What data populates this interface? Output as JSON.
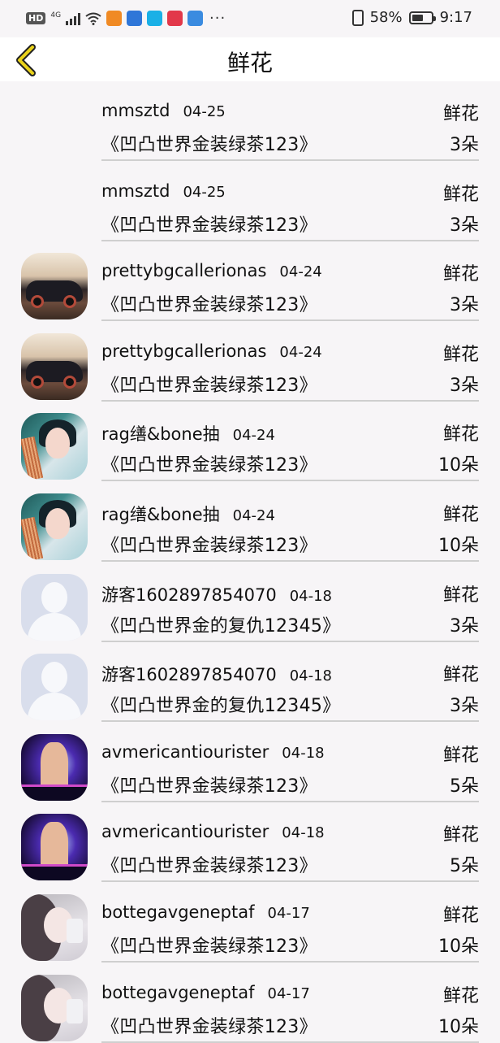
{
  "status_bar": {
    "hd": "HD",
    "network": "4G",
    "battery": "58%",
    "battery_level": 0.58,
    "time": "9:17",
    "more": "···",
    "app_icon_colors": [
      "#f08a24",
      "#2f76d8",
      "#1ab0e6",
      "#e2384a",
      "#3a8be0"
    ]
  },
  "header": {
    "title": "鲜花",
    "back_icon": "chevron-left-icon",
    "accent": "#e9d21a"
  },
  "records": [
    {
      "name": "mmsztd",
      "date": "04-25",
      "type": "鲜花",
      "work": "《凹凸世界金装绿茶123》",
      "qty": "3朵",
      "avatar": "none"
    },
    {
      "name": "mmsztd",
      "date": "04-25",
      "type": "鲜花",
      "work": "《凹凸世界金装绿茶123》",
      "qty": "3朵",
      "avatar": "none"
    },
    {
      "name": "prettybgcallerionas",
      "date": "04-24",
      "type": "鲜花",
      "work": "《凹凸世界金装绿茶123》",
      "qty": "3朵",
      "avatar": "car"
    },
    {
      "name": "prettybgcallerionas",
      "date": "04-24",
      "type": "鲜花",
      "work": "《凹凸世界金装绿茶123》",
      "qty": "3朵",
      "avatar": "car"
    },
    {
      "name": "rag缮&bone抽",
      "date": "04-24",
      "type": "鲜花",
      "work": "《凹凸世界金装绿茶123》",
      "qty": "10朵",
      "avatar": "girl"
    },
    {
      "name": "rag缮&bone抽",
      "date": "04-24",
      "type": "鲜花",
      "work": "《凹凸世界金装绿茶123》",
      "qty": "10朵",
      "avatar": "girl"
    },
    {
      "name": "游客1602897854070",
      "date": "04-18",
      "type": "鲜花",
      "work": "《凹凸世界金的复仇12345》",
      "qty": "3朵",
      "avatar": "guest"
    },
    {
      "name": "游客1602897854070",
      "date": "04-18",
      "type": "鲜花",
      "work": "《凹凸世界金的复仇12345》",
      "qty": "3朵",
      "avatar": "guest"
    },
    {
      "name": "avmericantiourister",
      "date": "04-18",
      "type": "鲜花",
      "work": "《凹凸世界金装绿茶123》",
      "qty": "5朵",
      "avatar": "dj"
    },
    {
      "name": "avmericantiourister",
      "date": "04-18",
      "type": "鲜花",
      "work": "《凹凸世界金装绿茶123》",
      "qty": "5朵",
      "avatar": "dj"
    },
    {
      "name": "bottegavgeneptaf",
      "date": "04-17",
      "type": "鲜花",
      "work": "《凹凸世界金装绿茶123》",
      "qty": "10朵",
      "avatar": "anime"
    },
    {
      "name": "bottegavgeneptaf",
      "date": "04-17",
      "type": "鲜花",
      "work": "《凹凸世界金装绿茶123》",
      "qty": "10朵",
      "avatar": "anime"
    }
  ]
}
